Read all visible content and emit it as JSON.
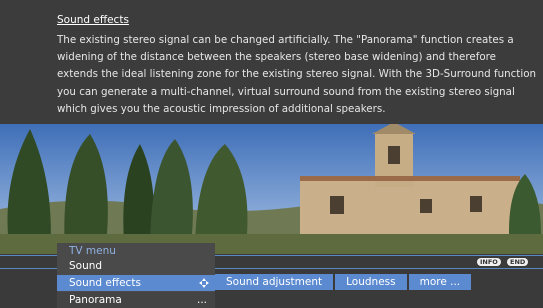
{
  "help": {
    "title": "Sound effects",
    "text": "The existing stereo signal can be changed artificially. The \"Panorama\" function creates a widening of the distance between the speakers (stereo base widening) and therefore extends the ideal listening zone for the existing stereo signal. With the 3D-Surround function you can generate a multi-channel, virtual surround sound from the existing stereo signal which gives you the acoustic impression of additional speakers."
  },
  "keys": {
    "info": "INFO",
    "end": "END"
  },
  "menu": {
    "header": "TV menu",
    "items": [
      {
        "label": "Sound",
        "state": "normal"
      },
      {
        "label": "Sound effects",
        "state": "selected",
        "icon": "navigate-cross-icon"
      },
      {
        "label": "Panorama",
        "state": "normal",
        "suffix": "..."
      }
    ]
  },
  "submenu": {
    "items": [
      "Sound adjustment",
      "Loudness",
      "more ..."
    ]
  },
  "colors": {
    "accent": "#5b8ad0",
    "header_text": "#8fb2e0",
    "background": "#3a3a3a"
  }
}
